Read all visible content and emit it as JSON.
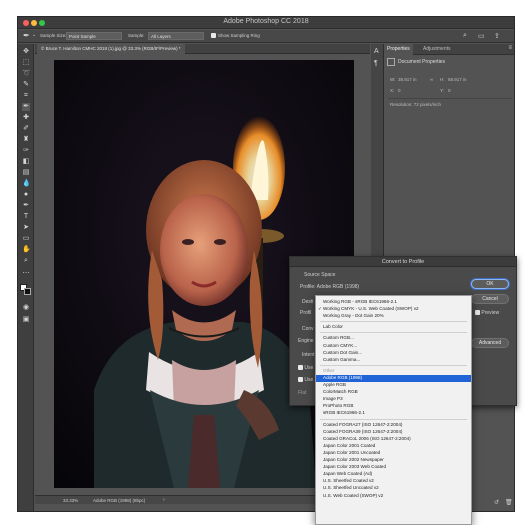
{
  "window": {
    "title": "Adobe Photoshop CC 2018",
    "traffic_colors": [
      "#fc605c",
      "#fdbc40",
      "#34c749"
    ]
  },
  "options_bar": {
    "sample_size_label": "Sample Size:",
    "sample_size_value": "Point Sample",
    "sample_label": "Sample:",
    "sample_value": "All Layers",
    "show_ring_label": "Show Sampling Ring"
  },
  "document": {
    "tab_label": "© Bruce T. Hamilton CMHC 2018 (1).jpg @ 33.3% (RGB/8*/Preview) *"
  },
  "status_bar": {
    "zoom": "33.33%",
    "profile": "Adobe RGB (1998) (8bpc)"
  },
  "properties_panel": {
    "tabs": [
      "Properties",
      "Adjustments"
    ],
    "section": "Document Properties",
    "w_label": "W:",
    "w_value": "38.917 in",
    "h_label": "H:",
    "h_value": "58.917 in",
    "x_label": "X:",
    "x_value": "0",
    "y_label": "Y:",
    "y_value": "0",
    "resolution": "Resolution: 72 pixels/inch"
  },
  "dialog": {
    "title": "Convert to Profile",
    "source_space": "Source Space",
    "profile_line": "Profile: Adobe RGB (1998)",
    "dest_label": "Desti",
    "profile_label": "Profil",
    "conv_label": "Conv",
    "engine_label": "Engine",
    "intent_label": "Intent",
    "use_label_1": "Use",
    "use_label_2": "Use",
    "flatten_label": "Flat",
    "ok": "OK",
    "cancel": "Cancel",
    "preview": "Preview",
    "advanced": "Advanced"
  },
  "profile_menu": {
    "items": [
      {
        "label": "Working RGB - sRGB IEC61966-2.1",
        "state": "normal",
        "checked": false
      },
      {
        "label": "Working CMYK - U.S. Web Coated (SWOP) v2",
        "state": "normal",
        "checked": true
      },
      {
        "label": "Working Gray - Dot Gain 20%",
        "state": "normal",
        "checked": false
      },
      {
        "label": "Lab Color",
        "state": "normal",
        "checked": false
      },
      {
        "label": "Custom RGB...",
        "state": "normal",
        "checked": false
      },
      {
        "label": "Custom CMYK...",
        "state": "normal",
        "checked": false
      },
      {
        "label": "Custom Dot Gain...",
        "state": "normal",
        "checked": false
      },
      {
        "label": "Custom Gamma...",
        "state": "normal",
        "checked": false
      },
      {
        "label": "Other",
        "state": "disabled",
        "checked": false
      },
      {
        "label": "Adobe RGB (1998)",
        "state": "highlight",
        "checked": false
      },
      {
        "label": "Apple RGB",
        "state": "normal",
        "checked": false
      },
      {
        "label": "ColorMatch RGB",
        "state": "normal",
        "checked": false
      },
      {
        "label": "Image P3",
        "state": "normal",
        "checked": false
      },
      {
        "label": "ProPhoto RGB",
        "state": "normal",
        "checked": false
      },
      {
        "label": "sRGB IEC61966-2.1",
        "state": "normal",
        "checked": false
      },
      {
        "label": "Coated FOGRA27 (ISO 12647-2:2004)",
        "state": "normal",
        "checked": false
      },
      {
        "label": "Coated FOGRA39 (ISO 12647-2:2004)",
        "state": "normal",
        "checked": false
      },
      {
        "label": "Coated GRACoL 2006 (ISO 12647-2:2004)",
        "state": "normal",
        "checked": false
      },
      {
        "label": "Japan Color 2001 Coated",
        "state": "normal",
        "checked": false
      },
      {
        "label": "Japan Color 2001 Uncoated",
        "state": "normal",
        "checked": false
      },
      {
        "label": "Japan Color 2002 Newspaper",
        "state": "normal",
        "checked": false
      },
      {
        "label": "Japan Color 2003 Web Coated",
        "state": "normal",
        "checked": false
      },
      {
        "label": "Japan Web Coated (Ad)",
        "state": "normal",
        "checked": false
      },
      {
        "label": "U.S. Sheetfed Coated v2",
        "state": "normal",
        "checked": false
      },
      {
        "label": "U.S. Sheetfed Uncoated v2",
        "state": "normal",
        "checked": false
      },
      {
        "label": "U.S. Web Coated (SWOP) v2",
        "state": "normal",
        "checked": false
      }
    ]
  }
}
